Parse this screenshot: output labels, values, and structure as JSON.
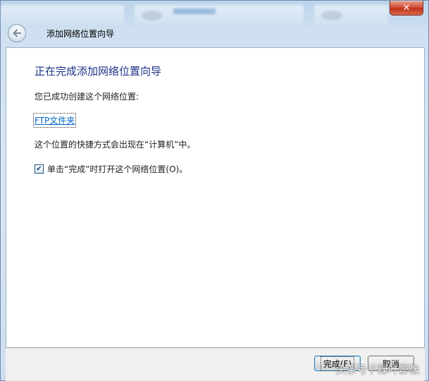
{
  "window": {
    "title": "添加网络位置向导",
    "close_icon": "close-icon",
    "back_icon": "back-arrow-icon"
  },
  "wizard": {
    "heading": "正在完成添加网络位置向导",
    "success_text": "您已成功创建这个网络位置:",
    "location_link": "FTP文件夹",
    "shortcut_text": "这个位置的快捷方式会出现在“计算机”中。",
    "open_checkbox": {
      "label": "单击“完成”时打开这个网络位置(O)。",
      "checked": true
    }
  },
  "footer": {
    "finish_label": "完成(F)",
    "cancel_label": "取消"
  },
  "watermark": "头条号 / 绿叶影像",
  "colors": {
    "heading": "#1e3287",
    "link": "#0066cc",
    "close": "#c2321a"
  }
}
